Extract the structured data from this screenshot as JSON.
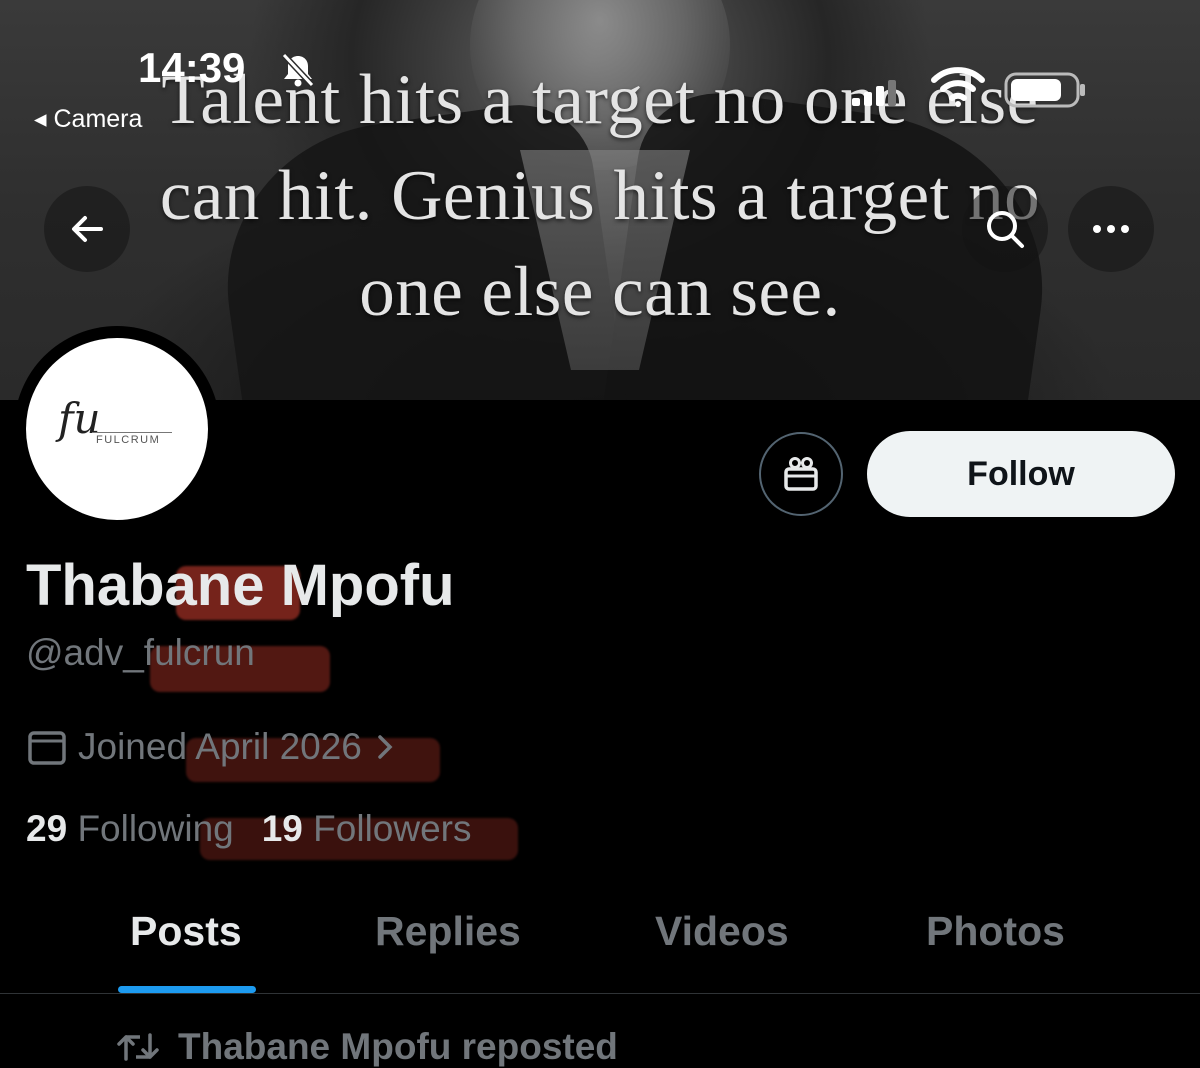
{
  "status_bar": {
    "time": "14:39",
    "back_app": "◂ Camera"
  },
  "banner": {
    "quote_lines": [
      "Talent hits a target no one else",
      "can hit. Genius hits a target no",
      "one else can see."
    ]
  },
  "header_controls": {
    "back": "back-arrow-icon",
    "search": "search-icon",
    "more": "more-icon"
  },
  "profile": {
    "avatar_monogram": "fu",
    "avatar_brand": "FULCRUM",
    "display_name": "Thabane Mpofu",
    "handle": "@adv_fulcrun",
    "joined": "Joined April 2026",
    "following_count": "29",
    "following_label": "Following",
    "followers_count": "19",
    "followers_label": "Followers"
  },
  "actions": {
    "follow_label": "Follow",
    "gift": "gift-icon"
  },
  "tabs": [
    {
      "label": "Posts",
      "active": true
    },
    {
      "label": "Replies",
      "active": false
    },
    {
      "label": "Videos",
      "active": false
    },
    {
      "label": "Photos",
      "active": false
    }
  ],
  "feed": {
    "repost_text": "Thabane Mpofu reposted"
  },
  "colors": {
    "accent": "#1d9bf0",
    "background": "#000000",
    "secondary_text": "#71767b",
    "highlight_red": "#d64032"
  }
}
